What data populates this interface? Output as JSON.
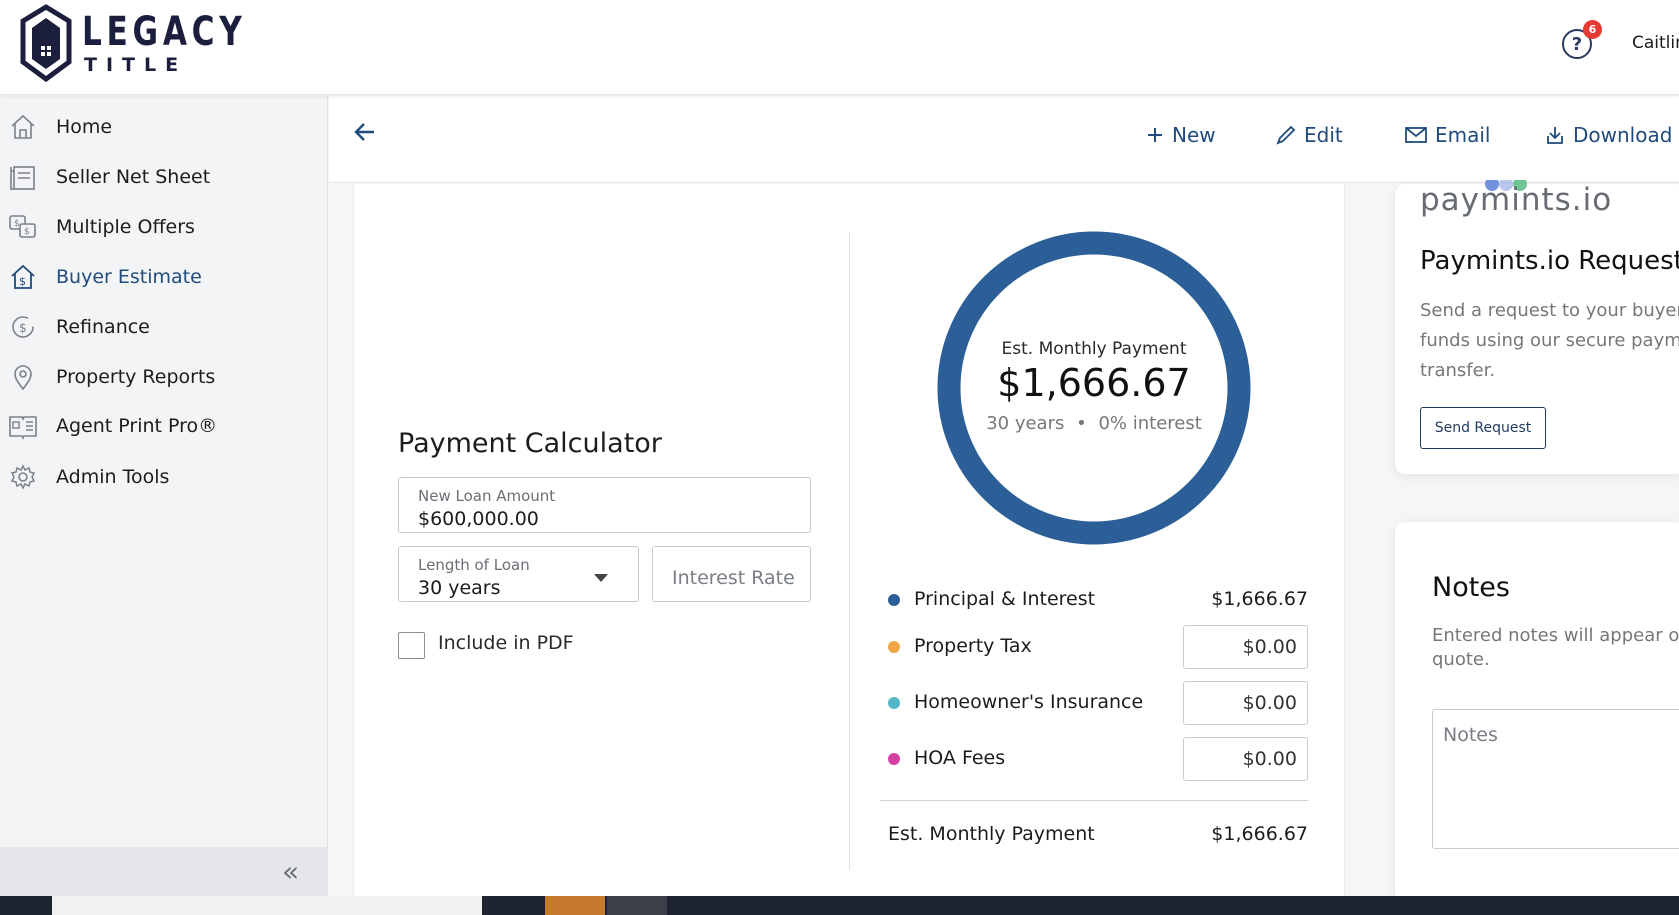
{
  "brand": {
    "line1": "LEGACY",
    "line2": "TITLE"
  },
  "header": {
    "help_badge": "6",
    "username": "Caitlin"
  },
  "sidebar": {
    "items": [
      {
        "label": "Home",
        "icon": "home-icon"
      },
      {
        "label": "Seller Net Sheet",
        "icon": "seller-net-sheet-icon"
      },
      {
        "label": "Multiple Offers",
        "icon": "multiple-offers-icon"
      },
      {
        "label": "Buyer Estimate",
        "icon": "buyer-estimate-icon",
        "active": true
      },
      {
        "label": "Refinance",
        "icon": "refinance-icon"
      },
      {
        "label": "Property Reports",
        "icon": "location-pin-icon"
      },
      {
        "label": "Agent Print Pro®",
        "icon": "agent-print-icon"
      },
      {
        "label": "Admin Tools",
        "icon": "gear-icon"
      }
    ],
    "collapse_glyph": "«"
  },
  "toolbar": {
    "new": "New",
    "edit": "Edit",
    "email": "Email",
    "download": "Download"
  },
  "calculator": {
    "title": "Payment Calculator",
    "loan_amount_label": "New Loan Amount",
    "loan_amount_value": "$600,000.00",
    "length_label": "Length of Loan",
    "length_value": "30 years",
    "interest_placeholder": "Interest Rate",
    "include_pdf_label": "Include in PDF",
    "include_pdf_checked": false
  },
  "summary": {
    "caption": "Est. Monthly Payment",
    "amount": "$1,666.67",
    "term": "30 years",
    "separator": "•",
    "interest": "0% interest",
    "ring_color": "#2c5f97"
  },
  "breakdown": [
    {
      "label": "Principal & Interest",
      "value": "$1,666.67",
      "color": "#2c5f97",
      "editable": false
    },
    {
      "label": "Property Tax",
      "value": "$0.00",
      "color": "#f0a847",
      "editable": true
    },
    {
      "label": "Homeowner's Insurance",
      "value": "$0.00",
      "color": "#55b8c8",
      "editable": true
    },
    {
      "label": "HOA Fees",
      "value": "$0.00",
      "color": "#d83fa3",
      "editable": true
    }
  ],
  "total": {
    "label": "Est. Monthly Payment",
    "value": "$1,666.67"
  },
  "paymints": {
    "logo": "paymints.io",
    "title": "Paymints.io Request",
    "description": "Send a request to your buyer funds using our secure payme transfer.",
    "button": "Send Request"
  },
  "notes": {
    "title": "Notes",
    "description": "Entered notes will appear o quote.",
    "placeholder": "Notes"
  }
}
